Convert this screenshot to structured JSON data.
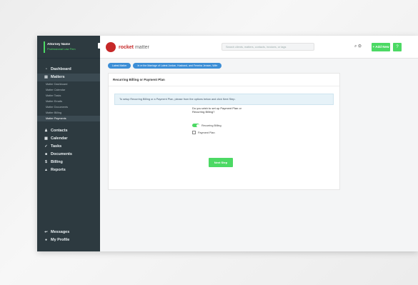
{
  "user": {
    "name": "Attorney Name",
    "firm": "Professional Law Firm"
  },
  "sidebar": {
    "items": [
      {
        "label": "Dashboard",
        "icon": "gauge-icon"
      },
      {
        "label": "Matters",
        "icon": "briefcase-icon"
      }
    ],
    "matter_sub": [
      "Matter Dashboard",
      "Matter Calendar",
      "Matter Tasks",
      "Matter Emails",
      "Matter Documents",
      "Matter Billing",
      "Matter Payments"
    ],
    "lower_items": [
      {
        "label": "Contacts",
        "icon": "users-icon"
      },
      {
        "label": "Calendar",
        "icon": "calendar-icon"
      },
      {
        "label": "Tasks",
        "icon": "check-icon"
      },
      {
        "label": "Documents",
        "icon": "folder-icon"
      },
      {
        "label": "Billing",
        "icon": "dollar-icon"
      },
      {
        "label": "Reports",
        "icon": "chart-icon"
      }
    ],
    "bottom_items": [
      {
        "label": "Messages",
        "icon": "message-icon"
      },
      {
        "label": "My Profile",
        "icon": "person-icon"
      }
    ]
  },
  "topbar": {
    "logo_main": "rocket",
    "logo_sub": "matter",
    "search_placeholder": "Search clients, matters, contacts, invoices, or tags",
    "new_label": "+ Add New",
    "help_icon": "help-icon"
  },
  "breadcrumb": [
    "Latest Matter",
    "In re the Marriage of Latest Jordan, Husband, and Ferreira Jensen, Wife"
  ],
  "panel": {
    "title": "Recurring Billing or Payment Plan",
    "info": "To setup Recurring Billing or a Payment Plan, please from the options below and click Next Step.",
    "question": "Do you wish to set up Payment Plan or Recurring Billing?",
    "option1": "Recurring Billing",
    "option2": "Payment Plan",
    "next_label": "Next Step"
  },
  "colors": {
    "accent": "#4cd964",
    "sidebar": "#2d3a40",
    "brand": "#c62828",
    "crumb": "#3c8ed6"
  }
}
